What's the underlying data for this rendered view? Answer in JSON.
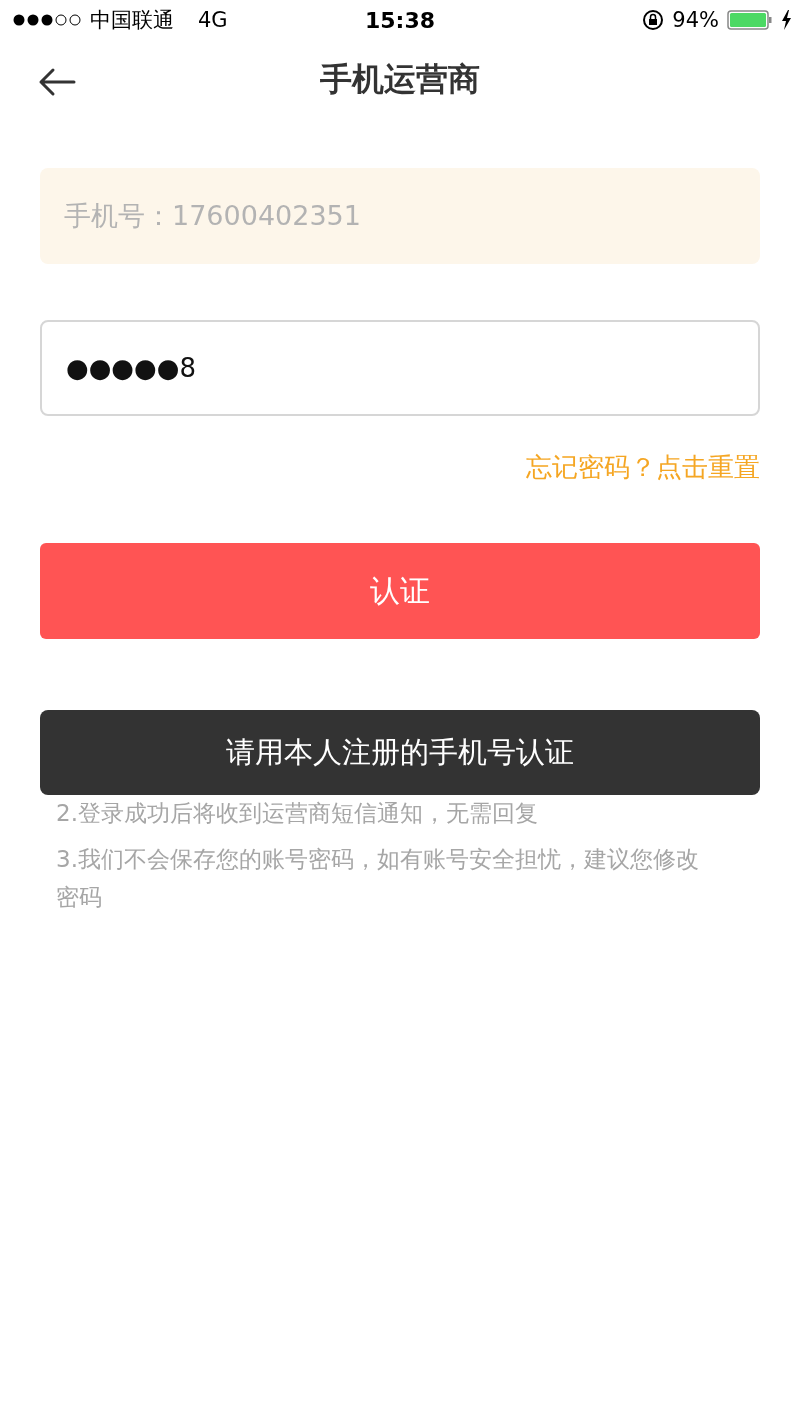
{
  "status_bar": {
    "carrier": "中国联通",
    "network": "4G",
    "time": "15:38",
    "battery": "94%"
  },
  "nav": {
    "title": "手机运营商"
  },
  "phone_field": {
    "value": "手机号：17600402351",
    "disabled": true
  },
  "password_field": {
    "value": "●●●●●8"
  },
  "forgot_link": "忘记密码？点击重置",
  "submit_button": "认证",
  "tips": {
    "items": [
      "2.登录成功后将收到运营商短信通知，无需回复",
      "3.我们不会保存您的账号密码，如有账号安全担忧，建议您修改密码"
    ]
  },
  "toast": "请用本人注册的手机号认证"
}
